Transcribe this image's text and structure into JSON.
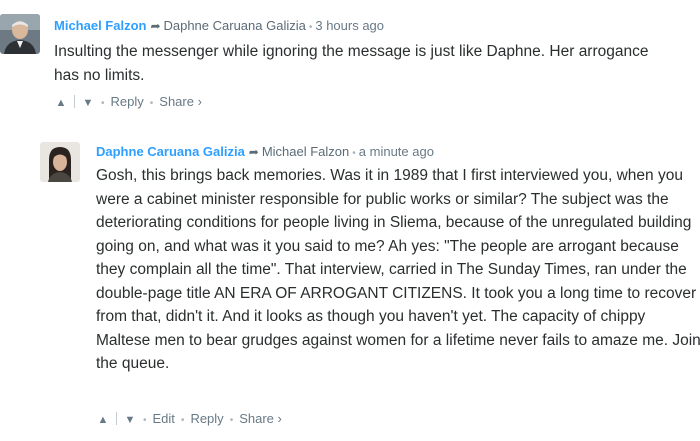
{
  "comments": [
    {
      "author": "Michael Falzon",
      "reply_to": "Daphne Caruana Galizia",
      "time": "3 hours ago",
      "text": "Insulting the messenger while ignoring the message is just like Daphne. Her arrogance has no limits.",
      "actions": {
        "reply": "Reply",
        "share": "Share ›"
      },
      "avatar": "avatar-michael-falzon"
    },
    {
      "author": "Daphne Caruana Galizia",
      "reply_to": "Michael Falzon",
      "time": "a minute ago",
      "text": "Gosh, this brings back memories. Was it in 1989 that I first interviewed you, when you were a cabinet minister responsible for public works or similar? The subject was the deteriorating conditions for people living in Sliema, because of the unregulated building going on, and what was it you said to me? Ah yes: \"The people are arrogant because they complain all the time\". That interview, carried in The Sunday Times, ran under the double-page title AN ERA OF ARROGANT CITIZENS. It took you a long time to recover from that, didn't it. And it looks as though you haven't yet. The capacity of chippy Maltese men to bear grudges against women for a lifetime never fails to amaze me. Join the queue.",
      "actions": {
        "edit": "Edit",
        "reply": "Reply",
        "share": "Share ›"
      },
      "avatar": "avatar-daphne-caruana-galizia"
    }
  ],
  "icons": {
    "reply_arrow": "reply-arrow-icon",
    "upvote": "upvote-icon",
    "downvote": "downvote-icon"
  },
  "colors": {
    "author_link": "#2e9fff",
    "meta_text": "#687a86",
    "body_text": "#2a2e2e"
  }
}
